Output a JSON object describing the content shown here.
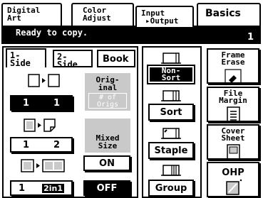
{
  "tabs": [
    {
      "line1": "Digital",
      "line2": "Art"
    },
    {
      "line1": "Color",
      "line2": "Adjust"
    },
    {
      "line1": "Input",
      "line2": "▸Output"
    },
    {
      "line1": "Basics",
      "line2": ""
    }
  ],
  "status": {
    "message": "Ready to copy.",
    "count": "1"
  },
  "subtabs": [
    {
      "line1": "1-",
      "line2": "Side"
    },
    {
      "line1": "2-",
      "line2": "Side"
    },
    {
      "label": "Book"
    }
  ],
  "left": {
    "mode1": {
      "left": "1",
      "right": "1"
    },
    "mode2": {
      "left": "1",
      "right": "2"
    },
    "mode3": {
      "left": "1",
      "right": "2in1"
    }
  },
  "original": {
    "line1": "Orig-",
    "line2": "inal",
    "sub1": "# of",
    "sub2": "Origs"
  },
  "mixed": {
    "line1": "Mixed",
    "line2": "Size",
    "on": "ON",
    "off": "OFF"
  },
  "output": {
    "nonsort1": "Non-",
    "nonsort2": "Sort",
    "sort": "Sort",
    "staple": "Staple",
    "group": "Group"
  },
  "functions": [
    {
      "line1": "Frame",
      "line2": "Erase"
    },
    {
      "line1": "File",
      "line2": "Margin"
    },
    {
      "line1": "Cover",
      "line2": "Sheet"
    },
    {
      "line1": "OHP",
      "line2": ""
    }
  ],
  "colors": {
    "selected": "#000000",
    "disabled_bg": "#c9c9c9"
  }
}
